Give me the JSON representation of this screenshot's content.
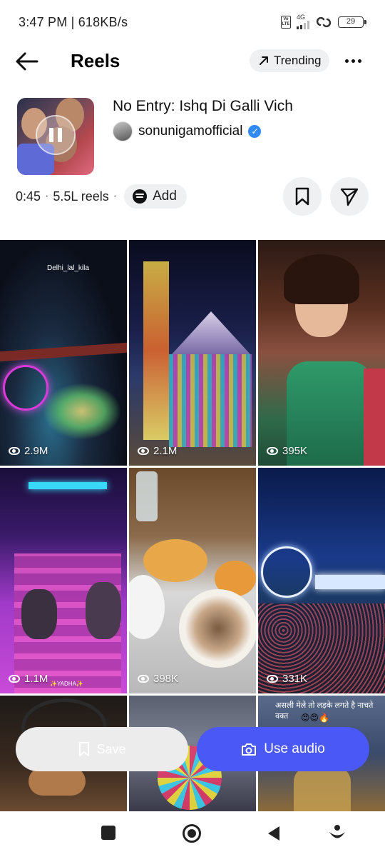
{
  "status_bar": {
    "time": "3:47 PM | 618KB/s",
    "volte": "Vo LTE",
    "network": "4G",
    "battery": "29"
  },
  "header": {
    "title": "Reels",
    "trending_label": "Trending"
  },
  "audio": {
    "title": "No Entry: Ishq Di Galli Vich",
    "artist": "sonunigamofficial",
    "verified": true,
    "duration": "0:45",
    "reels_count": "5.5L reels",
    "add_label": "Add"
  },
  "grid": {
    "tiles": [
      {
        "views": "2.9M",
        "caption": "Delhi_lal_kila"
      },
      {
        "views": "2.1M"
      },
      {
        "views": "395K"
      },
      {
        "views": "1.1M",
        "caption": "✨YADHA✨"
      },
      {
        "views": "398K"
      },
      {
        "views": "331K"
      },
      {
        "views": ""
      },
      {
        "views": ""
      },
      {
        "views": "",
        "caption": "असली मेले तो लड़के लगते है नाचते वक्त"
      }
    ]
  },
  "actions": {
    "save_label": "Save",
    "use_audio_label": "Use audio"
  },
  "colors": {
    "accent": "#4a58f5",
    "verified": "#2f8af5",
    "chip_bg": "#eef0f2"
  },
  "icons": [
    "back-arrow-icon",
    "trending-arrow-icon",
    "more-icon",
    "pause-icon",
    "spotify-icon",
    "bookmark-icon",
    "send-icon",
    "eye-icon",
    "camera-icon",
    "recents-icon",
    "home-icon",
    "back-icon",
    "assistant-icon"
  ]
}
